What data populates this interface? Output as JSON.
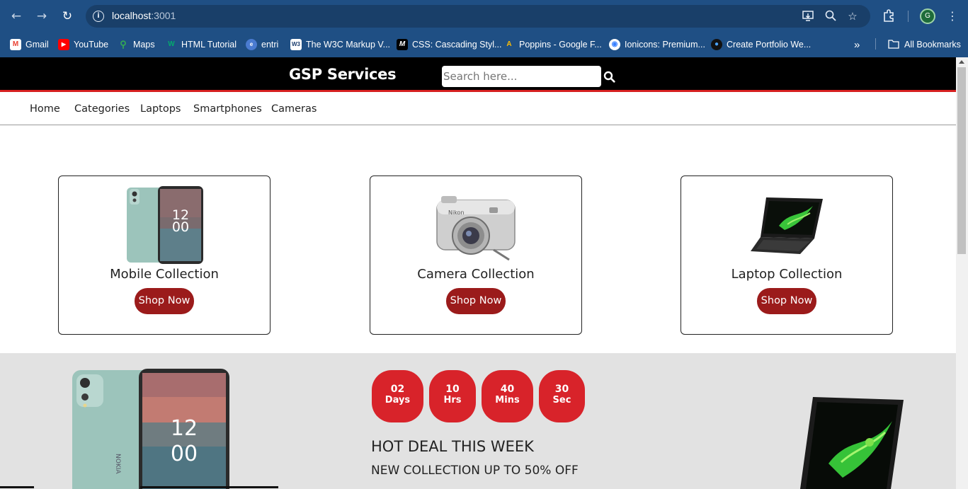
{
  "browser": {
    "url_host": "localhost",
    "url_port": ":3001",
    "profile_initial": "G",
    "bookmarks": [
      {
        "label": "Gmail",
        "icon": "gmail-icon",
        "color": "#ea4335"
      },
      {
        "label": "YouTube",
        "icon": "youtube-icon",
        "color": "#ff0000"
      },
      {
        "label": "Maps",
        "icon": "maps-icon",
        "color": "#34a853"
      },
      {
        "label": "HTML Tutorial",
        "icon": "w3schools-icon",
        "color": "#04aa6d"
      },
      {
        "label": "entri",
        "icon": "entri-icon",
        "color": "#4a7bd0"
      },
      {
        "label": "The W3C Markup V...",
        "icon": "w3c-icon",
        "color": "#ffffff"
      },
      {
        "label": "CSS: Cascading Styl...",
        "icon": "mdn-icon",
        "color": "#000000"
      },
      {
        "label": "Poppins - Google F...",
        "icon": "google-fonts-icon",
        "color": "#fbbc04"
      },
      {
        "label": "Ionicons: Premium...",
        "icon": "ionicons-icon",
        "color": "#ffffff"
      },
      {
        "label": "Create Portfolio We...",
        "icon": "portfolio-icon",
        "color": "#111111"
      }
    ],
    "all_bookmarks_label": "All Bookmarks"
  },
  "header": {
    "brand": "GSP Services",
    "search_placeholder": "Search here..."
  },
  "menu": [
    "Home",
    "Categories",
    "Laptops",
    "Smartphones",
    "Cameras"
  ],
  "collections": [
    {
      "title": "Mobile Collection",
      "button": "Shop Now",
      "image": "smartphone"
    },
    {
      "title": "Camera Collection",
      "button": "Shop Now",
      "image": "camera"
    },
    {
      "title": "Laptop Collection",
      "button": "Shop Now",
      "image": "laptop"
    }
  ],
  "deal": {
    "timer": [
      {
        "value": "02",
        "unit": "Days"
      },
      {
        "value": "10",
        "unit": "Hrs"
      },
      {
        "value": "40",
        "unit": "Mins"
      },
      {
        "value": "30",
        "unit": "Sec"
      }
    ],
    "title": "HOT DEAL THIS WEEK",
    "subtitle": "NEW COLLECTION UP TO 50% OFF"
  },
  "colors": {
    "chrome": "#1f4f84",
    "header_bg": "#000000",
    "accent_red": "#d62020",
    "button_red": "#9b1b1b",
    "timer_red": "#d8232a",
    "deal_bg": "#e2e2e2"
  },
  "phone_screen_time": [
    "12",
    "00"
  ]
}
